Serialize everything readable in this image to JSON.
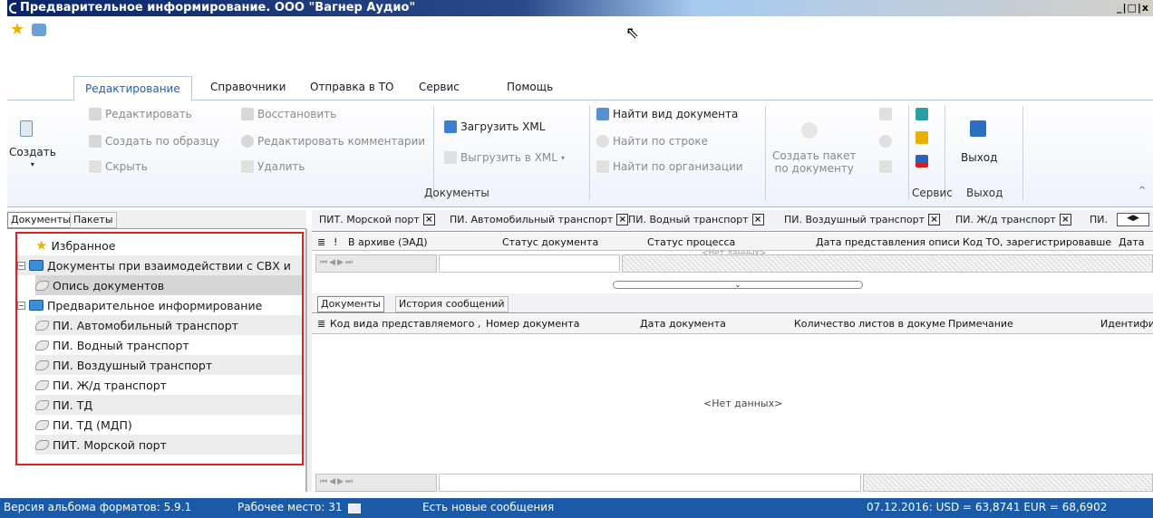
{
  "window": {
    "title": "Предварительное информирование. ООО \"Вагнер Аудио\"",
    "controls": "_|□|x"
  },
  "ribbon_tabs": [
    "Редактирование",
    "Справочники",
    "Отправка в ТО",
    "Сервис",
    "Помощь"
  ],
  "ribbon": {
    "create": "Создать",
    "edit": "Редактировать",
    "create_by_sample": "Создать по образцу",
    "hide": "Скрыть",
    "restore": "Восстановить",
    "edit_comments": "Редактировать комментарии",
    "delete": "Удалить",
    "load_xml": "Загрузить XML",
    "unload_xml": "Выгрузить в XML",
    "find_doc_type": "Найти вид документа",
    "find_by_row": "Найти по строке",
    "find_by_org": "Найти по организации",
    "create_package_1": "Создать пакет",
    "create_package_2": "по документу",
    "exit": "Выход",
    "group_documents": "Документы",
    "group_service": "Сервис",
    "group_exit": "Выход"
  },
  "left_tabs": [
    "Документы",
    "Пакеты"
  ],
  "tree": {
    "favorites": "Избранное",
    "svh_docs": "Документы при взаимодействии с СВХ и",
    "inventory": "Опись документов",
    "prelim": "Предварительное информирование",
    "items": [
      "ПИ. Автомобильный транспорт",
      "ПИ. Водный транспорт",
      "ПИ. Воздушный транспорт",
      "ПИ. Ж/д транспорт",
      "ПИ. ТД",
      "ПИ. ТД (МДП)",
      "ПИТ. Морской порт"
    ]
  },
  "doc_tabs": [
    "ПИТ. Морской порт",
    "ПИ. Автомобильный транспорт",
    "ПИ. Водный транспорт",
    "ПИ. Воздушный транспорт",
    "ПИ. Ж/д транспорт",
    "ПИ."
  ],
  "top_grid": {
    "headers": [
      "!",
      "В архиве (ЭАД)",
      "Статус документа",
      "Статус процесса",
      "Дата представления описи",
      "Код ТО, зарегистрировавше",
      "Дата"
    ],
    "empty": "<Нет данных>"
  },
  "sub_tabs": [
    "Документы",
    "История сообщений"
  ],
  "bottom_grid": {
    "headers": [
      "Код вида представляемого ,",
      "Номер документа",
      "Дата документа",
      "Количество листов в докуме",
      "Примечание",
      "Идентифи"
    ],
    "empty": "<Нет данных>"
  },
  "status": {
    "version": "Версия альбома форматов: 5.9.1",
    "workplace": "Рабочее место: 31",
    "messages": "Есть новые сообщения",
    "rates": "07.12.2016:  USD = 63,8741  EUR = 68,6902"
  }
}
